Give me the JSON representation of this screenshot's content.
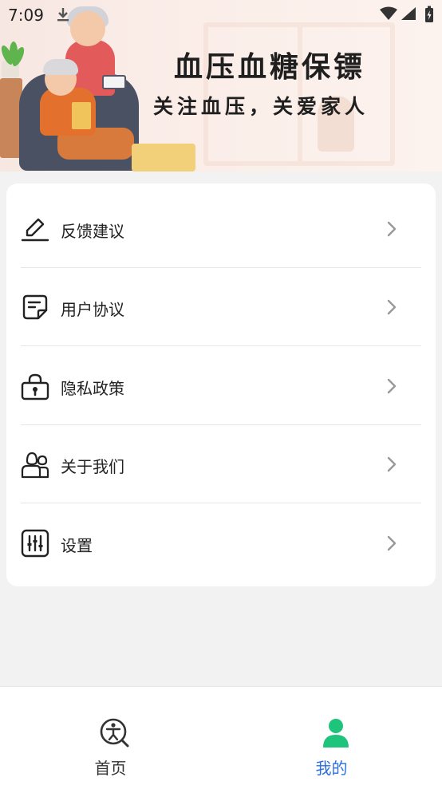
{
  "status_bar": {
    "time": "7:09"
  },
  "banner": {
    "title": "血压血糖保镖",
    "subtitle": "关注血压，关爱家人"
  },
  "menu": {
    "items": [
      {
        "label": "反馈建议",
        "icon": "pencil-icon"
      },
      {
        "label": "用户协议",
        "icon": "document-icon"
      },
      {
        "label": "隐私政策",
        "icon": "lock-icon"
      },
      {
        "label": "关于我们",
        "icon": "people-icon"
      },
      {
        "label": "设置",
        "icon": "sliders-icon"
      }
    ]
  },
  "bottom_nav": {
    "tabs": [
      {
        "label": "首页",
        "icon": "home-accessibility-icon",
        "active": false
      },
      {
        "label": "我的",
        "icon": "person-icon",
        "active": true
      }
    ]
  },
  "colors": {
    "accent_green": "#1ec47c",
    "active_tab_text": "#2b6fe0",
    "inactive_tab_text": "#333333"
  }
}
